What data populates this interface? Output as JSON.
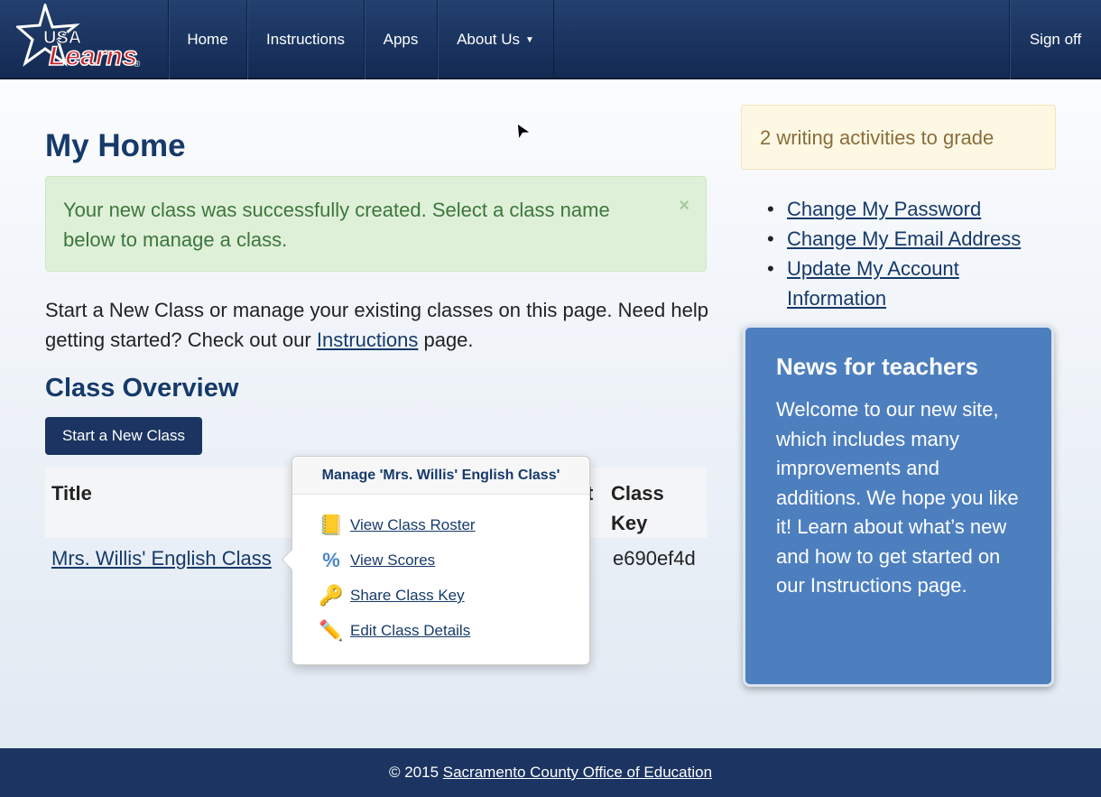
{
  "nav": {
    "logo_text": "USA Learns",
    "items": [
      "Home",
      "Instructions",
      "Apps",
      "About Us"
    ],
    "sign_off": "Sign off"
  },
  "page": {
    "title": "My Home",
    "alert": "Your new class was successfully created. Select a class name below to manage a class.",
    "alert_close": "×",
    "intro_before": "Start a New Class or manage your existing classes on this page. Need help getting started? Check out our ",
    "intro_link": "Instructions",
    "intro_after": " page.",
    "class_overview": "Class Overview",
    "start_button": "Start a New Class",
    "table": {
      "headers": [
        "Title",
        "t",
        "Class Key"
      ],
      "rows": [
        {
          "title": "Mrs. Willis' English Class",
          "key": "e690ef4d"
        }
      ]
    }
  },
  "popover": {
    "title": "Manage 'Mrs. Willis' English Class'",
    "items": [
      {
        "label": "View Class Roster",
        "icon": "roster-book-icon"
      },
      {
        "label": "View Scores",
        "icon": "percent-icon"
      },
      {
        "label": "Share Class Key",
        "icon": "key-icon"
      },
      {
        "label": "Edit Class Details",
        "icon": "pencil-icon"
      }
    ]
  },
  "sidebar": {
    "notice": "2 writing activities to grade",
    "links": [
      "Change My Password",
      "Change My Email Address",
      "Update My Account Information"
    ],
    "news_title": "News for teachers",
    "news_body": "Welcome to our new site, which includes many improvements and additions. We hope you like it! Learn about what’s new and how to get started on our Instructions page."
  },
  "footer": {
    "copyright": "© 2015 ",
    "link": "Sacramento County Office of Education"
  }
}
